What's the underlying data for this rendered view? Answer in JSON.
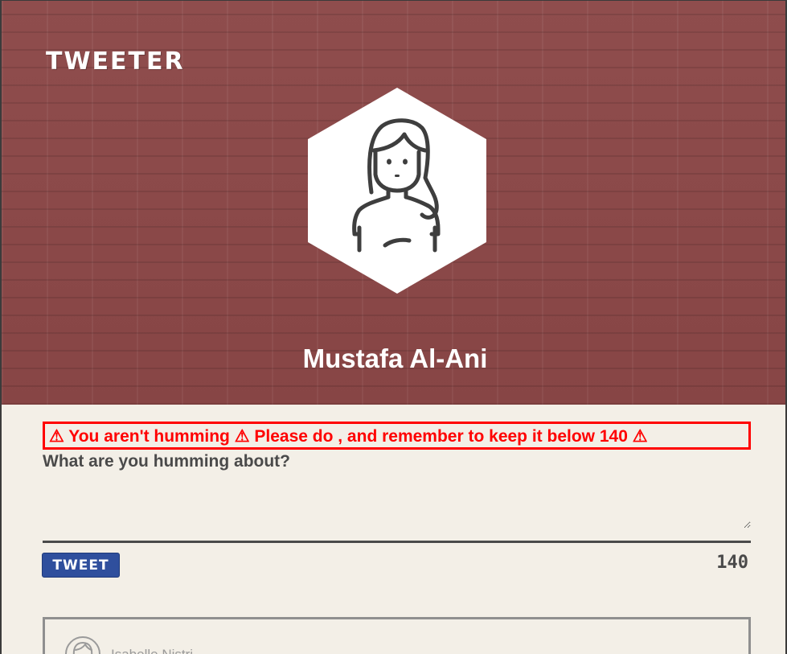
{
  "app": {
    "brand": "TWEETER"
  },
  "profile": {
    "name": "Mustafa Al-Ani",
    "avatar_icon": "woman-avatar-icon"
  },
  "compose": {
    "error_message": "⚠ You aren't humming ⚠ Please do , and remember to keep it below 140 ⚠",
    "prompt_label": "What are you humming about?",
    "textarea_value": "",
    "tweet_button_label": "TWEET",
    "char_count": "140"
  },
  "feed": {
    "items": [
      {
        "author_name": "Isabelle Nistri",
        "avatar_icon": "woman-avatar-icon"
      }
    ]
  },
  "colors": {
    "hero_bg": "#8c4a4a",
    "page_bg": "#f3efe7",
    "error": "#ff0000",
    "button": "#2f4f9d",
    "text_dark": "#4a4a4a"
  }
}
